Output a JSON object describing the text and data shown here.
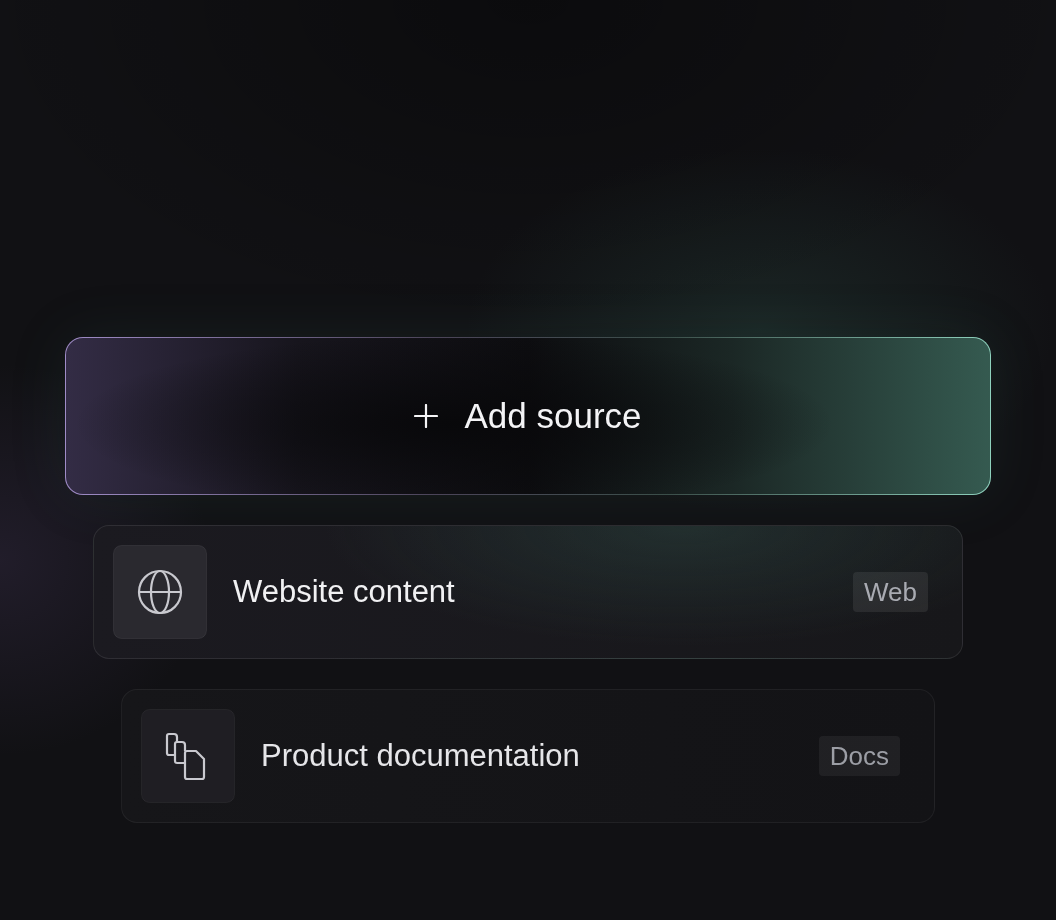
{
  "add_button": {
    "label": "Add source"
  },
  "sources": [
    {
      "kind": "web",
      "title": "Website content",
      "tag": "Web"
    },
    {
      "kind": "docs",
      "title": "Product documentation",
      "tag": "Docs"
    }
  ]
}
